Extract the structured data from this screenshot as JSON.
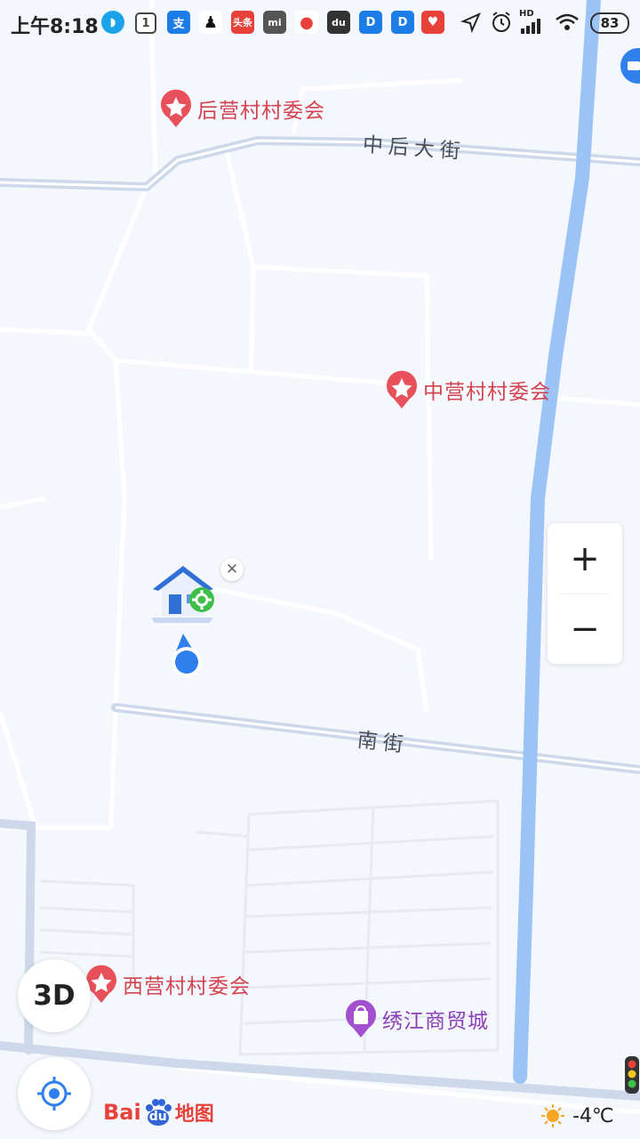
{
  "status_bar": {
    "time": "上午8:18",
    "battery": "83",
    "network": "HD"
  },
  "pois": [
    {
      "name": "后营村村委会",
      "type": "village"
    },
    {
      "name": "中营村村委会",
      "type": "village"
    },
    {
      "name": "西营村村委会",
      "type": "village"
    },
    {
      "name": "绣江商贸城",
      "type": "shopping"
    }
  ],
  "roads": {
    "north": "中后大街",
    "south": "南街"
  },
  "controls": {
    "zoom_in": "+",
    "zoom_out": "−",
    "three_d": "3D"
  },
  "branding": {
    "logo_latin": "Bai",
    "logo_du": "du",
    "logo_cn": "地图"
  },
  "weather": {
    "temperature": "-4℃"
  },
  "colors": {
    "poi_red": "#d2434f",
    "poi_purple": "#8b3fb8",
    "river": "#9cc3f5",
    "road": "#cdd9ea",
    "location_blue": "#2f80ed"
  }
}
